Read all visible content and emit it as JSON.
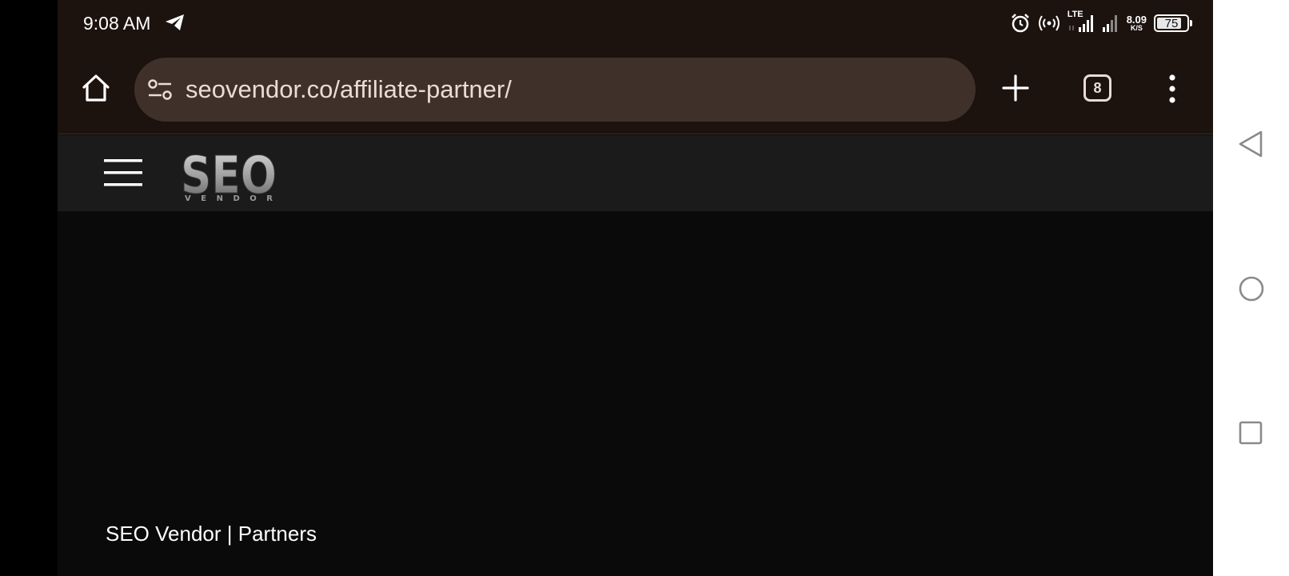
{
  "status_bar": {
    "time": "9:08 AM",
    "icons": [
      "telegram-icon",
      "alarm-icon",
      "hotspot-icon",
      "lte-signal-icon",
      "signal-icon"
    ],
    "lte_label": "LTE",
    "net_speed": "8.09",
    "net_speed_unit": "K/S",
    "battery": "75"
  },
  "browser": {
    "url": "seovendor.co/affiliate-partner/",
    "tab_count": "8"
  },
  "site": {
    "logo_text": "SEO",
    "logo_subtext": "VENDOR",
    "page_title": "SEO Vendor | Partners"
  },
  "colors": {
    "status_bg": "#1c120e",
    "urlbar_bg": "#3f3129",
    "header_bg": "#1b1b1b",
    "page_bg": "#0a0a0a"
  }
}
